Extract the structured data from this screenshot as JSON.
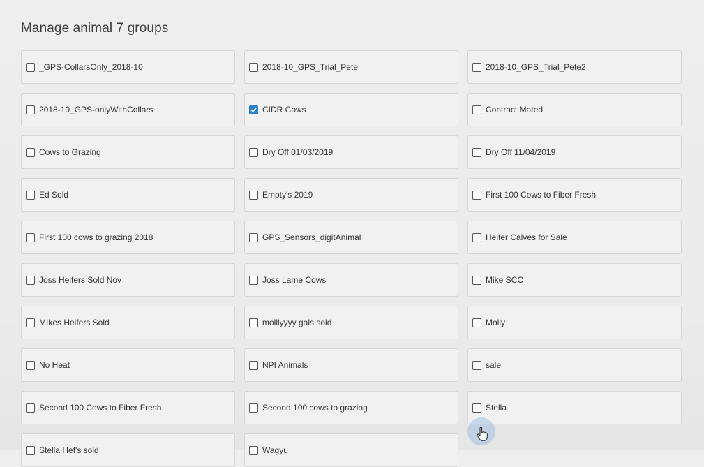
{
  "page": {
    "title": "Manage animal 7 groups"
  },
  "groups": [
    {
      "label": "_GPS-CollarsOnly_2018-10",
      "checked": false
    },
    {
      "label": "2018-10_GPS_Trial_Pete",
      "checked": false
    },
    {
      "label": "2018-10_GPS_Trial_Pete2",
      "checked": false
    },
    {
      "label": "2018-10_GPS-onlyWithCollars",
      "checked": false
    },
    {
      "label": "CIDR Cows",
      "checked": true
    },
    {
      "label": "Contract Mated",
      "checked": false
    },
    {
      "label": "Cows to Grazing",
      "checked": false
    },
    {
      "label": "Dry Off 01/03/2019",
      "checked": false
    },
    {
      "label": "Dry Off 11/04/2019",
      "checked": false
    },
    {
      "label": "Ed Sold",
      "checked": false
    },
    {
      "label": "Empty's 2019",
      "checked": false
    },
    {
      "label": "First 100 Cows to Fiber Fresh",
      "checked": false
    },
    {
      "label": "First 100 cows to grazing 2018",
      "checked": false
    },
    {
      "label": "GPS_Sensors_digitAnimal",
      "checked": false
    },
    {
      "label": "Heifer Calves for Sale",
      "checked": false
    },
    {
      "label": "Joss Heifers Sold Nov",
      "checked": false
    },
    {
      "label": "Joss Lame Cows",
      "checked": false
    },
    {
      "label": "Mike SCC",
      "checked": false
    },
    {
      "label": "MIkes Heifers Sold",
      "checked": false
    },
    {
      "label": "molllyyyy gals sold",
      "checked": false
    },
    {
      "label": "Molly",
      "checked": false
    },
    {
      "label": "No Heat",
      "checked": false
    },
    {
      "label": "NPI Animals",
      "checked": false
    },
    {
      "label": "sale",
      "checked": false
    },
    {
      "label": "Second 100 Cows to Fiber Fresh",
      "checked": false
    },
    {
      "label": "Second 100 cows to grazing",
      "checked": false
    },
    {
      "label": "Stella",
      "checked": false
    },
    {
      "label": "Stella Hef's sold",
      "checked": false
    },
    {
      "label": "Wagyu",
      "checked": false
    }
  ],
  "colors": {
    "checked_accent": "#2b82c9",
    "card_background": "#f1f1f1",
    "card_border": "#d6d6d6"
  },
  "icons": {
    "checkmark": "checkmark-icon",
    "cursor": "hand-pointer-icon"
  }
}
